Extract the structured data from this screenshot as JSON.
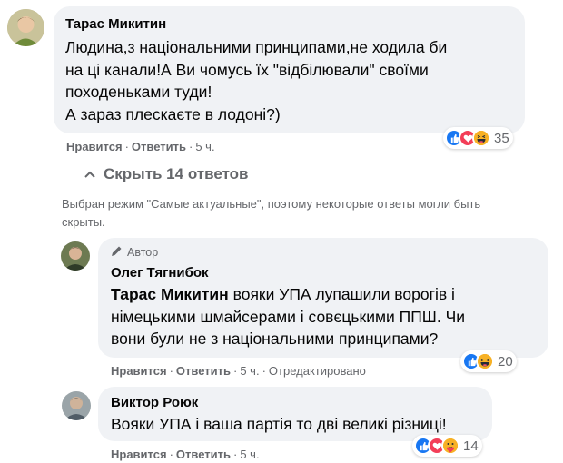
{
  "comment1": {
    "author": "Тарас Микитин",
    "lines": [
      "Людина,з національними принципами,не ходила би",
      "на ці канали!А Ви чомусь їх \"відбілювали\" своїми",
      "походеньками туди!",
      "А зараз плескаєте в лодоні?)"
    ],
    "like": "Нравится",
    "reply": "Ответить",
    "time": "5 ч.",
    "reaction_count": "35",
    "reactions": [
      "like",
      "love",
      "haha"
    ]
  },
  "toggle": {
    "label": "Скрыть 14 ответов",
    "icon": "chevron-up-icon"
  },
  "notice": {
    "line1": "Выбран режим \"Самые актуальные\", поэтому некоторые ответы могли быть",
    "line2": "скрыты."
  },
  "reply1": {
    "badge": "Автор",
    "author": "Олег Тягнибок",
    "mention": "Тарас Микитин",
    "line1_rest": " вояки УПА лупашили ворогів і",
    "line2": "німецькими шмайсерами і совєцькими ППШ. Чи",
    "line3": "вони були не з національними принципами?",
    "like": "Нравится",
    "reply": "Ответить",
    "time": "5 ч.",
    "edited": "Отредактировано",
    "reaction_count": "20",
    "reactions": [
      "like",
      "haha"
    ]
  },
  "reply2": {
    "author": "Виктор Роюк",
    "line1": "Вояки УПА і ваша партія то дві великі різниці!",
    "like": "Нравится",
    "reply": "Ответить",
    "time": "5 ч.",
    "reaction_count": "14",
    "reactions": [
      "like",
      "love",
      "care"
    ]
  },
  "colors": {
    "bubble": "#f0f2f5",
    "secondary_text": "#65676b",
    "like_blue": "#1877f2",
    "love_red": "#f33e58",
    "haha_yellow": "#f7b125"
  }
}
